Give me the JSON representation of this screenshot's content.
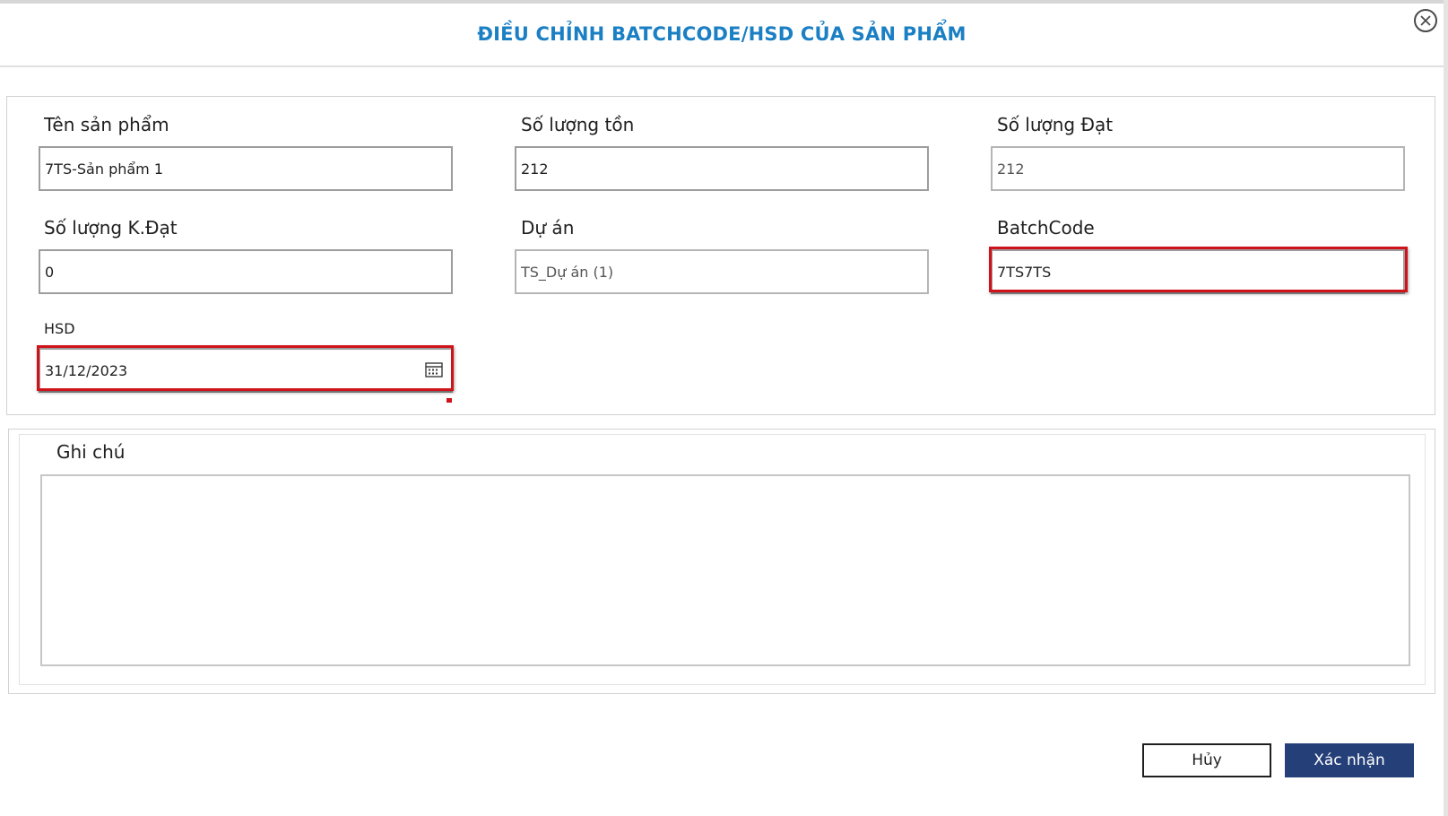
{
  "dialog": {
    "title": "ĐIỀU CHỈNH BATCHCODE/HSD CỦA SẢN PHẨM",
    "close_icon": "close-circle-icon"
  },
  "form": {
    "product_name": {
      "label": "Tên sản phẩm",
      "value": "7TS-Sản phẩm 1"
    },
    "stock_qty": {
      "label": "Số lượng tồn",
      "value": "212"
    },
    "pass_qty": {
      "label": "Số lượng Đạt",
      "value": "212"
    },
    "fail_qty": {
      "label": "Số lượng K.Đạt",
      "value": "0"
    },
    "project": {
      "label": "Dự án",
      "value": "TS_Dự án (1)"
    },
    "batch_code": {
      "label": "BatchCode",
      "value": "7TS7TS"
    },
    "expiry": {
      "label": "HSD",
      "value": "31/12/2023",
      "icon": "calendar-icon"
    }
  },
  "note": {
    "label": "Ghi chú",
    "value": ""
  },
  "actions": {
    "cancel_label": "Hủy",
    "confirm_label": "Xác nhận"
  },
  "colors": {
    "title": "#1b7fc4",
    "highlight": "#d0121b",
    "confirm_button": "#253f78"
  }
}
